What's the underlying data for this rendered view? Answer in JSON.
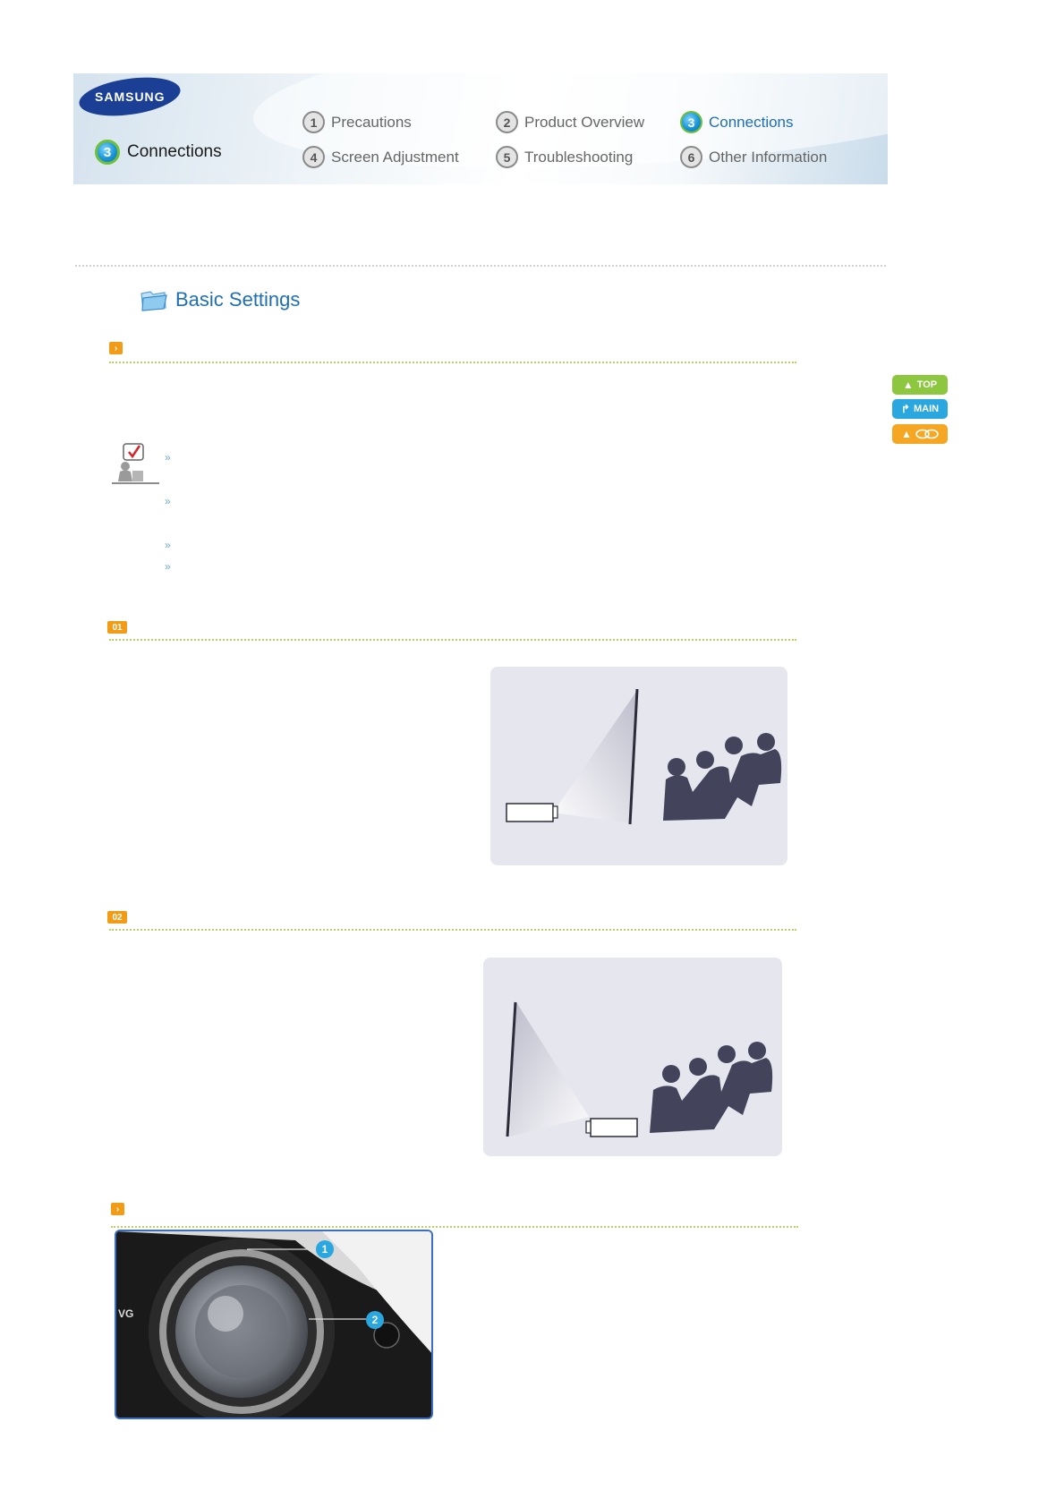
{
  "header": {
    "logo_text": "SAMSUNG",
    "current_section": {
      "number": "3",
      "label": "Connections"
    },
    "nav": [
      {
        "number": "1",
        "label": "Precautions",
        "active": false
      },
      {
        "number": "2",
        "label": "Product Overview",
        "active": false
      },
      {
        "number": "3",
        "label": "Connections",
        "active": true
      },
      {
        "number": "4",
        "label": "Screen Adjustment",
        "active": false
      },
      {
        "number": "5",
        "label": "Troubleshooting",
        "active": false
      },
      {
        "number": "6",
        "label": "Other Information",
        "active": false
      }
    ]
  },
  "page_title": "Basic Settings",
  "side_buttons": {
    "top": "TOP",
    "main": "MAIN"
  },
  "sections": {
    "s1_badge": "01",
    "s2_badge": "02"
  },
  "lens_callouts": [
    "1",
    "2"
  ],
  "colors": {
    "accent_blue": "#1f6fb2",
    "badge_orange": "#f29b17",
    "dotted_green": "#b8cf6a"
  }
}
